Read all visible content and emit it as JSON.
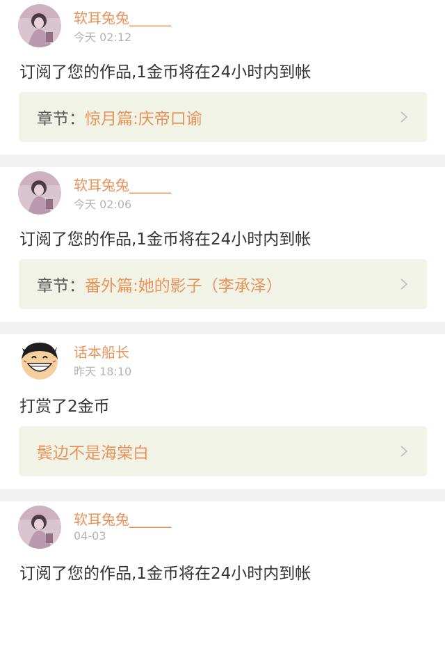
{
  "feed": [
    {
      "avatar": "girl-avatar",
      "username": "软耳兔兔______",
      "time": "今天 02:12",
      "message": "订阅了您的作品,1金币将在24小时内到帐",
      "link_prefix": "章节：",
      "link_value": "惊月篇:庆帝口谕"
    },
    {
      "avatar": "girl-avatar",
      "username": "软耳兔兔______",
      "time": "今天 02:06",
      "message": "订阅了您的作品,1金币将在24小时内到帐",
      "link_prefix": "章节：",
      "link_value": "番外篇:她的影子（李承泽）"
    },
    {
      "avatar": "cartoon-avatar",
      "username": "话本船长",
      "time": "昨天 18:10",
      "message": "打赏了2金币",
      "link_prefix": "",
      "link_value": "鬓边不是海棠白"
    },
    {
      "avatar": "girl-avatar",
      "username": "软耳兔兔______",
      "time": "04-03",
      "message": "订阅了您的作品,1金币将在24小时内到帐",
      "link_prefix": "",
      "link_value": ""
    }
  ],
  "colors": {
    "accent": "#e8935a",
    "link_bg": "#f1f3e6",
    "text": "#333333",
    "muted": "#b3b3b3",
    "page_bg": "#f2f2f2"
  },
  "icons": {
    "chevron": "chevron-right-icon"
  }
}
